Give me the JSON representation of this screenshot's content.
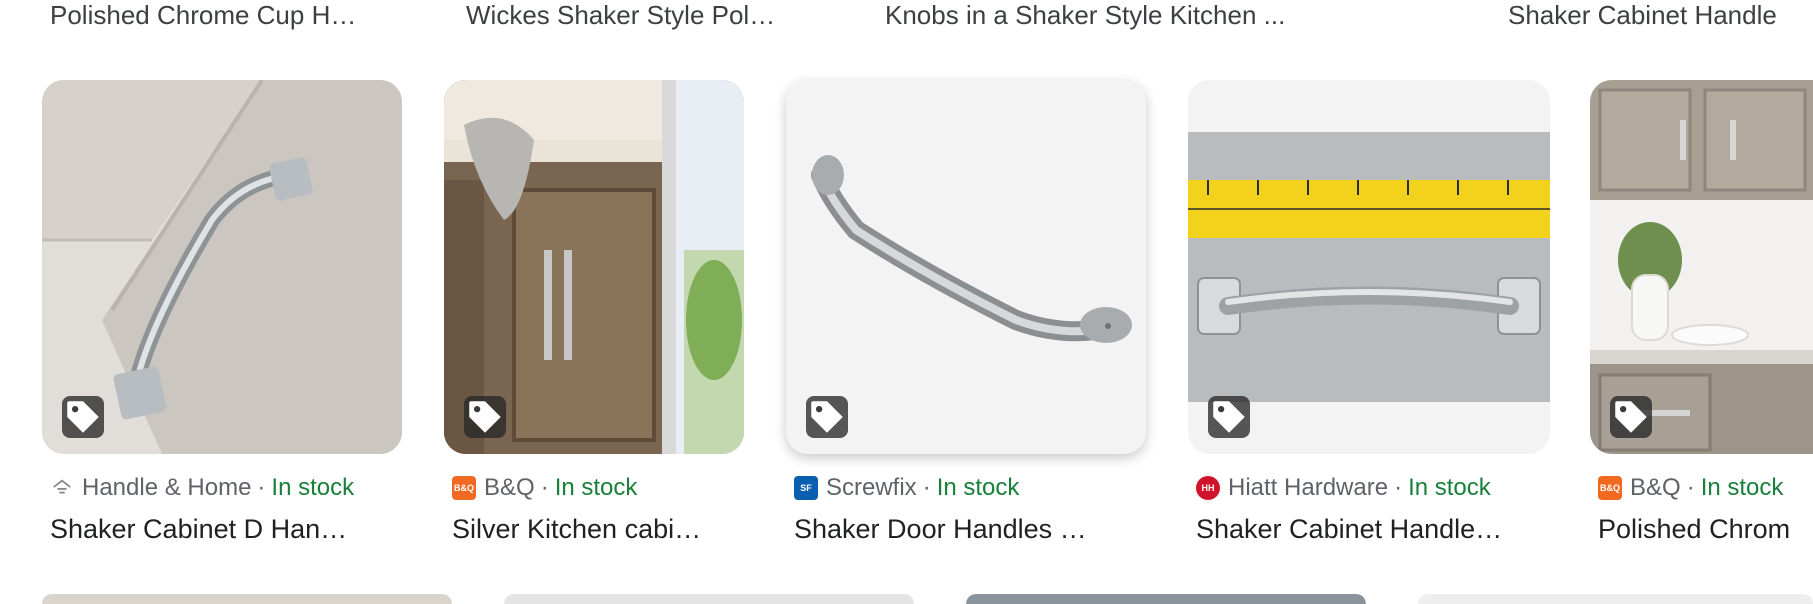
{
  "top_row": [
    "Polished Chrome Cup H…",
    "Wickes Shaker Style Pol…",
    "Knobs in a Shaker Style Kitchen ...",
    "Shaker Cabinet Handle"
  ],
  "results": [
    {
      "source": "Handle & Home",
      "stock": "In stock",
      "title": "Shaker Cabinet D Han…",
      "favicon_icon": "handle-home-favicon-icon"
    },
    {
      "source": "B&Q",
      "stock": "In stock",
      "title": "Silver Kitchen cabi…",
      "favicon_icon": "bq-favicon-icon",
      "favicon_text": "B&Q"
    },
    {
      "source": "Screwfix",
      "stock": "In stock",
      "title": "Shaker Door Handles …",
      "favicon_icon": "screwfix-favicon-icon",
      "favicon_text": "SF"
    },
    {
      "source": "Hiatt Hardware",
      "stock": "In stock",
      "title": "Shaker Cabinet Handle…",
      "favicon_icon": "hiatt-favicon-icon",
      "favicon_text": "HH"
    },
    {
      "source": "B&Q",
      "stock": "In stock",
      "title": "Polished Chrom",
      "favicon_icon": "bq-favicon-icon",
      "favicon_text": "B&Q"
    }
  ],
  "separator": "·",
  "colors": {
    "stock": "#188038",
    "bq": "#f26a21",
    "screwfix": "#0b5fb0",
    "hiatt": "#d0142c"
  }
}
